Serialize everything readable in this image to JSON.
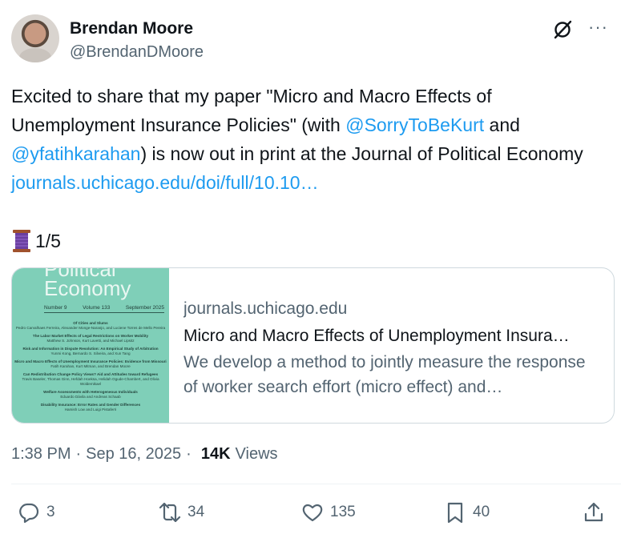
{
  "author": {
    "name": "Brendan Moore",
    "handle": "@BrendanDMoore"
  },
  "tweet": {
    "text_1": "Excited to share that my paper \"Micro and Macro Effects of Unemployment Insurance Policies\" (with ",
    "mention_1": "@SorryToBeKurt",
    "text_2": " and ",
    "mention_2": "@yfatihkarahan",
    "text_3": ") is now out in print at the Journal of Political Economy ",
    "link": "journals.uchicago.edu/doi/full/10.10…",
    "thread_counter": "1/5"
  },
  "card": {
    "domain": "journals.uchicago.edu",
    "title": "Micro and Macro Effects of Unemployment Insura…",
    "description": "We develop a method to jointly measure the response of worker search effort (micro effect) and…",
    "thumbnail": {
      "journal_line1": "Political",
      "journal_line2": "Economy",
      "number": "Number 9",
      "volume": "Volume 133",
      "date": "September 2025",
      "toc": [
        {
          "title": "Of Cities and Slums",
          "authors": "Pedro Carvalhaes Ferreira, Alexander Monge-Naranjo, and Luciene Torres de Mello Pereira"
        },
        {
          "title": "The Labor Market Effects of Legal Restrictions on Worker Mobility",
          "authors": "Matthew S. Johnson, Kurt Lavetti, and Michael Lipsitz"
        },
        {
          "title": "Risk and Information in Dispute Resolution: An Empirical Study of Arbitration",
          "authors": "Yunmi Kong, Bernardo S. Silveira, and Xun Tang"
        },
        {
          "title": "Micro and Macro Effects of Unemployment Insurance Policies: Evidence from Missouri",
          "authors": "Fatih Karahan, Kurt Mitman, and Brendan Moore"
        },
        {
          "title": "Can Redistribution Change Policy Views? Aid and Attitudes toward Refugees",
          "authors": "Travis Baseler, Thomas Ginn, Hefdah Hoeksa, Helidah Ogude-Chambert, and Olivia Woldemikael"
        },
        {
          "title": "Welfare Assessments with Heterogeneous Individuals",
          "authors": "Eduardo Dávila and Andreas Schaab"
        },
        {
          "title": "Disability Insurance: Error Rates and Gender Differences",
          "authors": "Hamish Low and Luigi Pistaferri"
        }
      ]
    }
  },
  "meta": {
    "time": "1:38 PM",
    "separator_1": "·",
    "date": "Sep 16, 2025",
    "separator_2": "·",
    "views_count": "14K",
    "views_label": "Views"
  },
  "actions": {
    "replies": "3",
    "reposts": "34",
    "likes": "135",
    "bookmarks": "40"
  },
  "icons": {
    "grok": "grok-icon",
    "more": "more-icon",
    "spool": "thread-spool-icon",
    "reply": "reply-icon",
    "repost": "repost-icon",
    "like": "heart-icon",
    "bookmark": "bookmark-icon",
    "share": "share-icon"
  },
  "colors": {
    "link": "#1d9bf0",
    "secondary_text": "#536471",
    "primary_text": "#0f1419",
    "thumbnail_bg": "#7fcfb8"
  }
}
